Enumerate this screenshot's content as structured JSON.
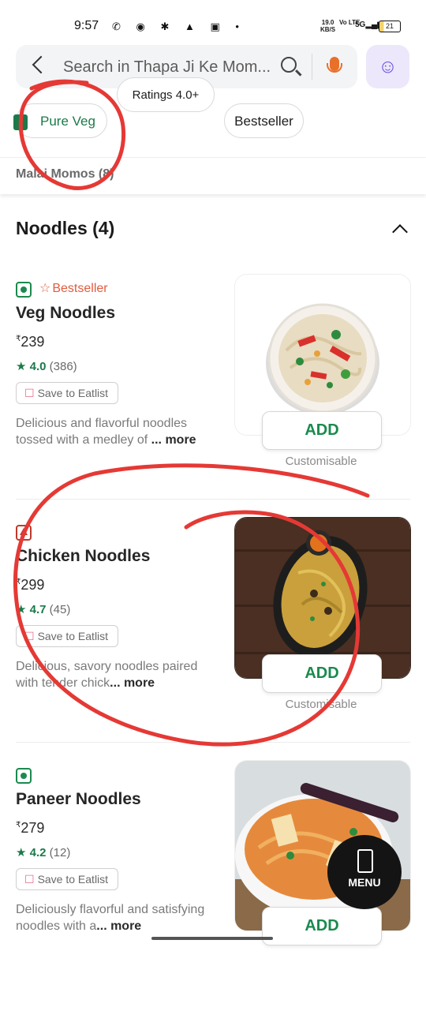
{
  "status_bar": {
    "time": "9:57",
    "icons": [
      "whatsapp-icon",
      "chat-icon",
      "bug-icon",
      "a-icon",
      "paytm-icon",
      "dot-icon"
    ],
    "net_speed": "19.0",
    "net_unit": "KB/S",
    "volte": "Vo LTE",
    "signal": "5G",
    "battery": "21"
  },
  "search": {
    "placeholder": "Search in Thapa Ji Ke Mom..."
  },
  "filters": [
    "Pure Veg",
    "Ratings 4.0+",
    "Bestseller"
  ],
  "category_strip": {
    "label": "Malai Momos (8)"
  },
  "section": {
    "title": "Noodles (4)"
  },
  "items": [
    {
      "type": "veg",
      "badge": "Bestseller",
      "name": "Veg Noodles",
      "currency": "₹",
      "price": "239",
      "rating": "4.0",
      "rating_count": "(386)",
      "save_label": "Save to Eatlist",
      "desc": "Delicious and flavorful noodles tossed with a medley of",
      "more": "... more",
      "add_label": "ADD",
      "customisable": "Customisable"
    },
    {
      "type": "non-veg",
      "badge": "",
      "name": "Chicken Noodles",
      "currency": "₹",
      "price": "299",
      "rating": "4.7",
      "rating_count": "(45)",
      "save_label": "Save to Eatlist",
      "desc": "Delicious, savory noodles paired with tender chick",
      "more": "... more",
      "add_label": "ADD",
      "customisable": "Customisable"
    },
    {
      "type": "veg",
      "badge": "",
      "name": "Paneer Noodles",
      "currency": "₹",
      "price": "279",
      "rating": "4.2",
      "rating_count": "(12)",
      "save_label": "Save to Eatlist",
      "desc": "Deliciously flavorful and satisfying noodles with a",
      "more": "... more",
      "add_label": "ADD",
      "customisable": ""
    }
  ],
  "menu_button": {
    "label": "MENU"
  },
  "colors": {
    "veg": "#1b8a4e",
    "non_veg": "#c0392b",
    "bestseller": "#e25b3f",
    "annotation": "#e53935",
    "accent": "#6b4ee6"
  }
}
